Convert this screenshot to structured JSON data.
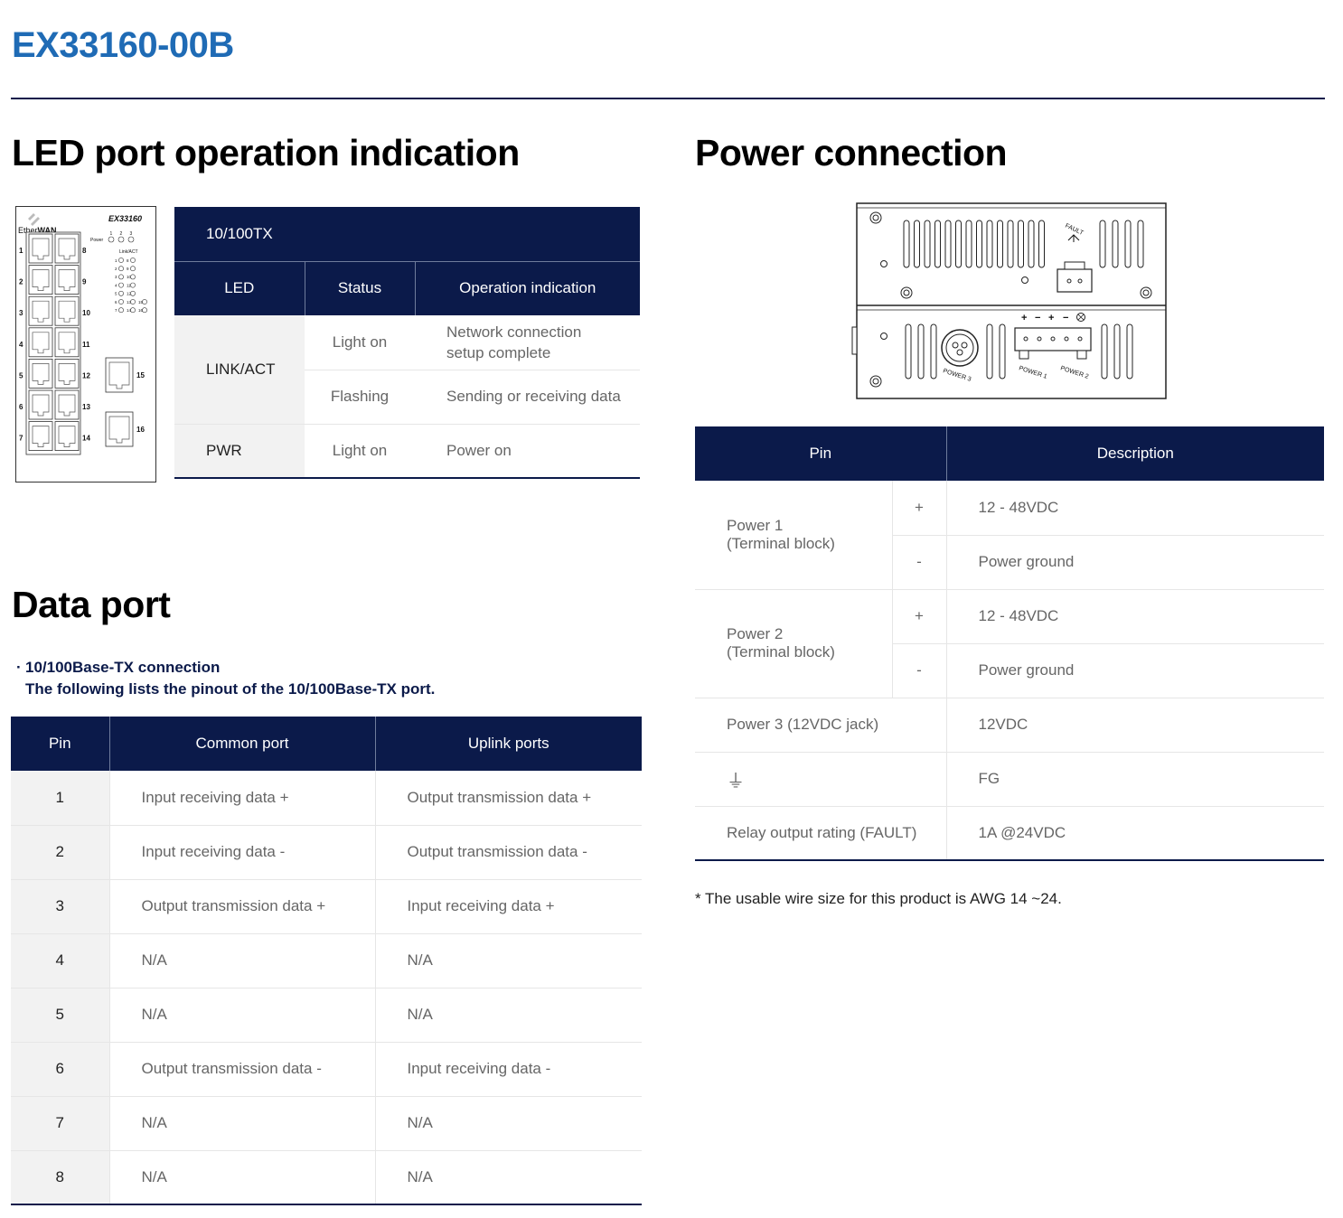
{
  "model": "EX33160-00B",
  "led_section": {
    "title": "LED port operation indication",
    "table_caption": "10/100TX",
    "headers": [
      "LED",
      "Status",
      "Operation indication"
    ],
    "rows": {
      "link_act": {
        "led": "LINK/ACT",
        "on": {
          "status": "Light on",
          "indication_line1": "Network connection",
          "indication_line2": "setup complete"
        },
        "flash": {
          "status": "Flashing",
          "indication": "Sending or receiving data"
        }
      },
      "pwr": {
        "led": "PWR",
        "status": "Light on",
        "indication": "Power on"
      }
    },
    "device": {
      "model_label": "EX33160",
      "brand_e": "E",
      "brand_ther": "ther",
      "brand_wan": "WAN",
      "power_label": "Power",
      "power_numbers": [
        "1",
        "2",
        "3"
      ],
      "linkact_label": "Link/ACT",
      "left_ports": [
        "1",
        "2",
        "3",
        "4",
        "5",
        "6",
        "7"
      ],
      "right_ports": [
        "8",
        "9",
        "10",
        "11",
        "12",
        "13",
        "14"
      ],
      "uplink_ports": [
        "15",
        "16"
      ],
      "led_rows": [
        [
          "1",
          "8"
        ],
        [
          "2",
          "9"
        ],
        [
          "3",
          "10"
        ],
        [
          "4",
          "11"
        ],
        [
          "5",
          "12"
        ],
        [
          "6",
          "13",
          "15"
        ],
        [
          "7",
          "14",
          "16"
        ]
      ]
    }
  },
  "data_port": {
    "title": "Data port",
    "bullet": "·",
    "intro_line1": "10/100Base-TX connection",
    "intro_line2": "The following lists the pinout of the 10/100Base-TX port.",
    "headers": [
      "Pin",
      "Common port",
      "Uplink ports"
    ],
    "rows": [
      {
        "pin": "1",
        "common": "Input receiving data +",
        "uplink": "Output transmission data +"
      },
      {
        "pin": "2",
        "common": "Input receiving data -",
        "uplink": "Output transmission data -"
      },
      {
        "pin": "3",
        "common": "Output transmission data +",
        "uplink": "Input receiving data +"
      },
      {
        "pin": "4",
        "common": "N/A",
        "uplink": "N/A"
      },
      {
        "pin": "5",
        "common": "N/A",
        "uplink": "N/A"
      },
      {
        "pin": "6",
        "common": "Output transmission data -",
        "uplink": "Input receiving data -"
      },
      {
        "pin": "7",
        "common": "N/A",
        "uplink": "N/A"
      },
      {
        "pin": "8",
        "common": "N/A",
        "uplink": "N/A"
      }
    ]
  },
  "power": {
    "title": "Power connection",
    "headers": [
      "Pin",
      "Description"
    ],
    "power1_line1": "Power 1",
    "power1_line2": "(Terminal block)",
    "power2_line1": "Power 2",
    "power2_line2": "(Terminal block)",
    "plus": "+",
    "minus": "-",
    "v_range": "12 - 48VDC",
    "ground": "Power ground",
    "power3": "Power 3 (12VDC jack)",
    "power3_desc": "12VDC",
    "fg_symbol": "⏚",
    "fg_desc": "FG",
    "relay": "Relay output rating (FAULT)",
    "relay_desc": "1A @24VDC",
    "device": {
      "fault_label": "FAULT",
      "terminal_signs": [
        "+",
        "−",
        "+",
        "−"
      ],
      "power3_label": "POWER 3",
      "power1_label": "POWER 1",
      "power2_label": "POWER 2"
    }
  },
  "note": "* The usable wire size for this product is AWG 14 ~24."
}
